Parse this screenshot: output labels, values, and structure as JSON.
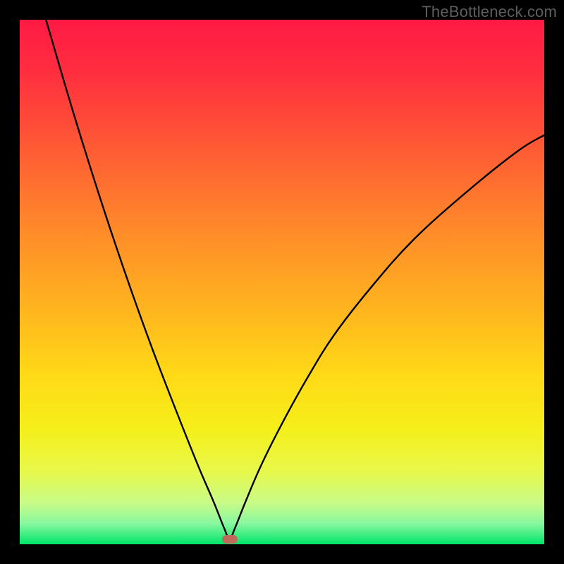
{
  "watermark": "TheBottleneck.com",
  "colors": {
    "background": "#000000",
    "gradient_stops": [
      {
        "offset": 0.0,
        "color": "#ff1a44"
      },
      {
        "offset": 0.1,
        "color": "#ff2e3f"
      },
      {
        "offset": 0.25,
        "color": "#ff5c34"
      },
      {
        "offset": 0.4,
        "color": "#ff8a2a"
      },
      {
        "offset": 0.55,
        "color": "#ffb41f"
      },
      {
        "offset": 0.68,
        "color": "#ffda17"
      },
      {
        "offset": 0.78,
        "color": "#f5ef1a"
      },
      {
        "offset": 0.86,
        "color": "#e8f84a"
      },
      {
        "offset": 0.92,
        "color": "#c9fb86"
      },
      {
        "offset": 0.96,
        "color": "#8af8a0"
      },
      {
        "offset": 1.0,
        "color": "#00e56a"
      }
    ],
    "curve": "#000000",
    "marker": "#c06a5a"
  },
  "chart_data": {
    "type": "line",
    "title": "",
    "xlabel": "",
    "ylabel": "",
    "xlim": [
      0,
      100
    ],
    "ylim": [
      0,
      100
    ],
    "note": "V-shaped curve on a vertical rainbow gradient (red top → green bottom). The curve reaches its minimum near x≈40 where a small rounded marker sits at the bottom.",
    "series": [
      {
        "name": "curve",
        "x": [
          5,
          10,
          15,
          20,
          25,
          30,
          34,
          37,
          39,
          40,
          41,
          43,
          46,
          50,
          55,
          60,
          67,
          75,
          85,
          95,
          100
        ],
        "y": [
          100,
          83,
          67,
          52,
          38,
          25,
          15,
          8,
          3,
          1,
          3,
          8,
          15,
          23,
          32,
          40,
          49,
          58,
          67,
          75,
          78
        ]
      }
    ],
    "minimum_marker": {
      "x": 40,
      "y": 1
    }
  }
}
